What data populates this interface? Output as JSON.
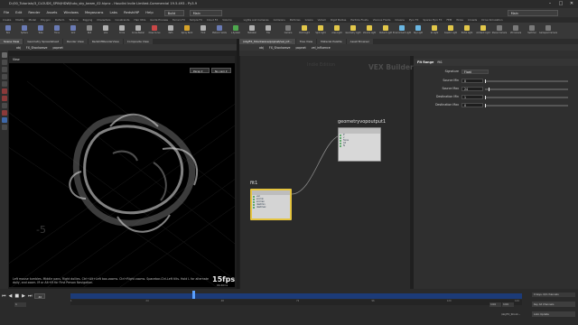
{
  "window": {
    "title": "D:/00_Tutorials/3_CLOUDS_SPIN/HDW/tuto_sky_beam_02.hipnc - Houdini Indie Limited-Commercial 19.5.493 - Py3.9",
    "minimize": "–",
    "maximize": "□",
    "close": "✕"
  },
  "menu": {
    "items": [
      "File",
      "Edit",
      "Render",
      "Assets",
      "Windows",
      "Megascans",
      "Labs",
      "RedshiftP",
      "Help"
    ],
    "build_dropdown": "Build",
    "desktop_dropdown": "Main",
    "search_dropdown": "Main"
  },
  "shelf": {
    "left_tabs": [
      "Create",
      "Modify",
      "Model",
      "Polygon",
      "Deform",
      "Texture",
      "Rigging",
      "Characters",
      "Constraints",
      "Hair Utils",
      "Guide Process",
      "Terrain FX",
      "Simple FX",
      "Cloud FX",
      "Volume"
    ],
    "right_tabs": [
      "Lights and Cameras",
      "Collisions",
      "Particles",
      "Grains",
      "Vellum",
      "Rigid Bodies",
      "Particle Fluids",
      "Viscous Fluids",
      "Oceans",
      "Pyro FX",
      "Sparse Pyro FX",
      "FEM",
      "Wires",
      "Crowds",
      "Drive Simulation"
    ],
    "left_tools": [
      {
        "label": "Box",
        "color": "#6a7bb5"
      },
      {
        "label": "Sphere",
        "color": "#6a7bb5"
      },
      {
        "label": "Tube",
        "color": "#6a7bb5"
      },
      {
        "label": "Torus",
        "color": "#6a7bb5"
      },
      {
        "label": "Grid",
        "color": "#6a7bb5"
      },
      {
        "label": "Null",
        "color": "#8a8a8a"
      },
      {
        "label": "Line",
        "color": "#b0b0b0"
      },
      {
        "label": "Circle",
        "color": "#b0b0b0"
      },
      {
        "label": "Curve Bezier",
        "color": "#b0b0b0"
      },
      {
        "label": "Draw Curve",
        "color": "#c94848"
      },
      {
        "label": "Path",
        "color": "#b0b0b0"
      },
      {
        "label": "Spray Paint",
        "color": "#d6a32a"
      },
      {
        "label": "Font",
        "color": "#b0b0b0"
      },
      {
        "label": "Platonic Solids",
        "color": "#6a7bb5"
      },
      {
        "label": "L-System",
        "color": "#4ea84e"
      },
      {
        "label": "Metaball",
        "color": "#b0b0b0"
      },
      {
        "label": "File",
        "color": "#b0b0b0"
      }
    ],
    "right_tools": [
      {
        "label": "Camera",
        "color": "#7a7a7a"
      },
      {
        "label": "Point Light",
        "color": "#e3c84a"
      },
      {
        "label": "Spot Light",
        "color": "#e3c84a"
      },
      {
        "label": "Area Light",
        "color": "#e3c84a"
      },
      {
        "label": "Geometry Light",
        "color": "#e3c84a"
      },
      {
        "label": "Volume Light",
        "color": "#e3c84a"
      },
      {
        "label": "Distant Light",
        "color": "#e3c84a"
      },
      {
        "label": "Environment Light",
        "color": "#6ab7e3"
      },
      {
        "label": "Sky Light",
        "color": "#6ab7e3"
      },
      {
        "label": "GI Light",
        "color": "#e3c84a"
      },
      {
        "label": "Caustic Light",
        "color": "#e3c84a"
      },
      {
        "label": "Portal Light",
        "color": "#e3c84a"
      },
      {
        "label": "Ambient Light",
        "color": "#e3c84a"
      },
      {
        "label": "Stereo Camera",
        "color": "#7a7a7a"
      },
      {
        "label": "VR Camera",
        "color": "#7a7a7a"
      },
      {
        "label": "Switcher",
        "color": "#7a7a7a"
      },
      {
        "label": "Gamepad Camera",
        "color": "#7a7a7a"
      }
    ]
  },
  "left_pane": {
    "tabs": [
      "Scene View",
      "Geometry Spreadsheet",
      "Render View",
      "RedshiftRenderView",
      "Composite View"
    ],
    "path": [
      "obj",
      "FX_Shockwave",
      "popnet"
    ],
    "view_label": "View",
    "camera_menu": "Persp ▾",
    "cam_menu": "No cam ▾",
    "status_line1": "Left mouse tumbles. Middle pans. Right dollies. Ctrl+Alt+Left box-zooms. Ctrl+Right zooms. Spacebar-Ctrl-Left tilts. Hold L for alternate",
    "status_line2": "dolly, and zoom.   M or Alt+M for First Person Navigation.",
    "fps": "15fps",
    "ms": "66.66ms",
    "grid_label": "-5"
  },
  "network_pane": {
    "tabs": [
      "/obj/FX_Shockwave/popnet/vel_inf...",
      "Tree View",
      "Material Palette",
      "Asset Browser"
    ],
    "path": [
      "obj",
      "FX_Shockwave",
      "popnet",
      "vel_influence"
    ],
    "context_label": "Indie Edition",
    "builder_label": "VEX Builder",
    "out_node": {
      "name": "geometryvopoutput1",
      "ports": [
        "P",
        "v",
        "force",
        "Cd",
        "N"
      ]
    },
    "fit_node": {
      "name": "fit1",
      "ports": [
        "val",
        "srcmin",
        "srcmax",
        "destmin",
        "destmax"
      ]
    }
  },
  "params": {
    "node_type": "Fit Range",
    "node_name": "fit1",
    "signature_label": "Signature",
    "signature_value": "Float",
    "rows": [
      {
        "label": "Source Min",
        "value": "0",
        "level": 0.0
      },
      {
        "label": "Source Max",
        "value": "24",
        "level": 0.04
      },
      {
        "label": "Destination Min",
        "value": "1",
        "level": 0.0
      },
      {
        "label": "Destination Max",
        "value": "0",
        "level": 0.0
      }
    ]
  },
  "timeline": {
    "current_frame": "40",
    "start_frame": "1",
    "end_frame": "144",
    "end_frame2": "144",
    "ticks": [
      "1",
      "24",
      "48",
      "72",
      "96",
      "120",
      "144"
    ],
    "keys_label": "0 keys, 0/0 channels",
    "key_all_label": "Key All Channels",
    "auto_update": "Auto Update",
    "path_label": "/obj/FX_Shock...",
    "progress": 0.27
  }
}
